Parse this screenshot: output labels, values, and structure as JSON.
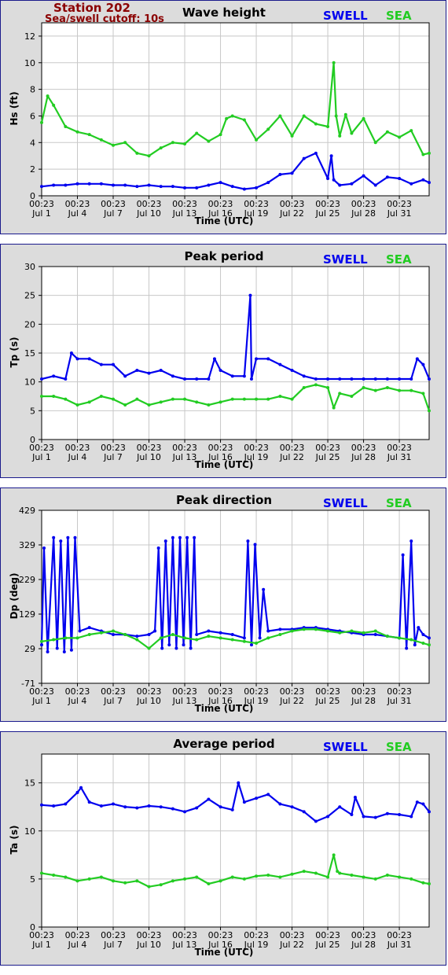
{
  "header": {
    "station": "Station 202",
    "cutoff": "Sea/swell cutoff: 10s"
  },
  "legend": {
    "swell": "SWELL",
    "sea": "SEA"
  },
  "colors": {
    "swell": "#0000ee",
    "sea": "#22cc22",
    "station": "#8b0000"
  },
  "x_ticks": [
    {
      "time": "00:23",
      "date": "Jul 1"
    },
    {
      "time": "00:23",
      "date": "Jul 4"
    },
    {
      "time": "00:23",
      "date": "Jul 7"
    },
    {
      "time": "00:23",
      "date": "Jul 10"
    },
    {
      "time": "00:23",
      "date": "Jul 13"
    },
    {
      "time": "00:23",
      "date": "Jul 16"
    },
    {
      "time": "00:23",
      "date": "Jul 19"
    },
    {
      "time": "00:23",
      "date": "Jul 22"
    },
    {
      "time": "00:23",
      "date": "Jul 25"
    },
    {
      "time": "00:23",
      "date": "Jul 28"
    },
    {
      "time": "00:23",
      "date": "Jul 31"
    }
  ],
  "chart_data": [
    {
      "type": "line",
      "title": "Wave height",
      "xlabel": "Time (UTC)",
      "ylabel": "Hs (ft)",
      "ylim": [
        0,
        13
      ],
      "yticks": [
        0,
        2,
        4,
        6,
        8,
        10,
        12
      ],
      "xlim": [
        0,
        32.5
      ],
      "grid": true,
      "series": [
        {
          "name": "SWELL",
          "x": [
            0,
            1,
            2,
            3,
            4,
            5,
            6,
            7,
            8,
            9,
            10,
            11,
            12,
            13,
            14,
            15,
            16,
            17,
            18,
            19,
            20,
            21,
            22,
            23,
            24,
            24.3,
            24.5,
            25,
            26,
            27,
            28,
            29,
            30,
            31,
            32,
            32.5
          ],
          "values": [
            0.7,
            0.8,
            0.8,
            0.9,
            0.9,
            0.9,
            0.8,
            0.8,
            0.7,
            0.8,
            0.7,
            0.7,
            0.6,
            0.6,
            0.8,
            1.0,
            0.7,
            0.5,
            0.6,
            1.0,
            1.6,
            1.7,
            2.8,
            3.2,
            1.3,
            3.0,
            1.2,
            0.8,
            0.9,
            1.5,
            0.8,
            1.4,
            1.3,
            0.9,
            1.2,
            1.0
          ]
        },
        {
          "name": "SEA",
          "x": [
            0,
            0.5,
            1,
            2,
            3,
            4,
            5,
            6,
            7,
            8,
            9,
            10,
            11,
            12,
            13,
            14,
            15,
            15.5,
            16,
            17,
            18,
            19,
            20,
            21,
            22,
            23,
            24,
            24.5,
            24.7,
            25,
            25.5,
            26,
            27,
            28,
            29,
            30,
            31,
            32,
            32.5
          ],
          "values": [
            5.5,
            7.5,
            6.8,
            5.2,
            4.8,
            4.6,
            4.2,
            3.8,
            4.0,
            3.2,
            3.0,
            3.6,
            4.0,
            3.9,
            4.7,
            4.1,
            4.6,
            5.8,
            6.0,
            5.7,
            4.2,
            5.0,
            6.0,
            4.5,
            6.0,
            5.4,
            5.2,
            10.0,
            6.0,
            4.5,
            6.1,
            4.7,
            5.8,
            4.0,
            4.8,
            4.4,
            4.9,
            3.1,
            3.2
          ]
        }
      ]
    },
    {
      "type": "line",
      "title": "Peak period",
      "xlabel": "Time (UTC)",
      "ylabel": "Tp (s)",
      "ylim": [
        0,
        30
      ],
      "yticks": [
        0,
        5,
        10,
        15,
        20,
        25,
        30
      ],
      "xlim": [
        0,
        32.5
      ],
      "grid": true,
      "series": [
        {
          "name": "SWELL",
          "x": [
            0,
            1,
            2,
            2.5,
            3,
            4,
            5,
            6,
            7,
            8,
            9,
            10,
            11,
            12,
            13,
            14,
            14.5,
            15,
            16,
            17,
            17.5,
            17.6,
            18,
            19,
            20,
            21,
            22,
            23,
            24,
            25,
            26,
            27,
            28,
            29,
            30,
            31,
            31.5,
            32,
            32.5
          ],
          "values": [
            10.5,
            11,
            10.5,
            15,
            14,
            14,
            13,
            13,
            11,
            12,
            11.5,
            12,
            11,
            10.5,
            10.5,
            10.5,
            14,
            12,
            11,
            11,
            25,
            10.5,
            14,
            14,
            13,
            12,
            11,
            10.5,
            10.5,
            10.5,
            10.5,
            10.5,
            10.5,
            10.5,
            10.5,
            10.5,
            14,
            13,
            10.5
          ]
        },
        {
          "name": "SEA",
          "x": [
            0,
            1,
            2,
            3,
            4,
            5,
            6,
            7,
            8,
            9,
            10,
            11,
            12,
            13,
            14,
            15,
            16,
            17,
            18,
            19,
            20,
            21,
            22,
            23,
            24,
            24.5,
            25,
            26,
            27,
            28,
            29,
            30,
            31,
            32,
            32.5
          ],
          "values": [
            7.5,
            7.5,
            7.0,
            6.0,
            6.5,
            7.5,
            7.0,
            6.0,
            7.0,
            6.0,
            6.5,
            7.0,
            7.0,
            6.5,
            6.0,
            6.5,
            7.0,
            7.0,
            7.0,
            7.0,
            7.5,
            7.0,
            9.0,
            9.5,
            9.0,
            5.5,
            8.0,
            7.5,
            9.0,
            8.5,
            9.0,
            8.5,
            8.5,
            8.0,
            5.0
          ]
        }
      ]
    },
    {
      "type": "line",
      "title": "Peak direction",
      "xlabel": "Time (UTC)",
      "ylabel": "Dp (deg)",
      "ylim": [
        -71,
        429
      ],
      "yticks": [
        -71,
        29,
        129,
        229,
        329,
        429
      ],
      "xlim": [
        0,
        32.5
      ],
      "grid": true,
      "series": [
        {
          "name": "SWELL",
          "x": [
            0,
            0.2,
            0.5,
            1,
            1.3,
            1.6,
            1.9,
            2.2,
            2.5,
            2.8,
            3.2,
            4,
            5,
            6,
            7,
            8,
            9,
            9.5,
            9.8,
            10.1,
            10.4,
            10.7,
            11,
            11.3,
            11.6,
            11.9,
            12.2,
            12.5,
            12.8,
            13,
            14,
            15,
            16,
            17,
            17.3,
            17.6,
            17.9,
            18.3,
            18.6,
            19,
            20,
            21,
            22,
            23,
            24,
            25,
            26,
            27,
            28,
            29,
            30,
            30.3,
            30.6,
            31,
            31.3,
            31.6,
            32,
            32.5
          ],
          "values": [
            40,
            320,
            20,
            350,
            30,
            340,
            20,
            350,
            25,
            350,
            80,
            90,
            80,
            70,
            70,
            65,
            70,
            80,
            320,
            30,
            340,
            40,
            350,
            30,
            350,
            40,
            350,
            30,
            350,
            70,
            80,
            75,
            70,
            60,
            340,
            40,
            330,
            60,
            200,
            80,
            85,
            85,
            90,
            90,
            85,
            80,
            75,
            70,
            70,
            65,
            60,
            300,
            30,
            340,
            40,
            90,
            70,
            60
          ]
        },
        {
          "name": "SEA",
          "x": [
            0,
            1,
            2,
            3,
            4,
            5,
            6,
            7,
            8,
            9,
            10,
            11,
            12,
            13,
            14,
            15,
            16,
            17,
            18,
            19,
            20,
            21,
            22,
            23,
            24,
            25,
            26,
            27,
            28,
            29,
            30,
            31,
            32,
            32.5
          ],
          "values": [
            50,
            55,
            60,
            60,
            70,
            75,
            80,
            70,
            55,
            30,
            60,
            70,
            60,
            55,
            65,
            60,
            55,
            50,
            45,
            60,
            70,
            80,
            85,
            85,
            80,
            75,
            80,
            75,
            80,
            65,
            60,
            55,
            45,
            40
          ]
        }
      ]
    },
    {
      "type": "line",
      "title": "Average period",
      "xlabel": "Time (UTC)",
      "ylabel": "Ta (s)",
      "ylim": [
        0,
        18
      ],
      "yticks": [
        0,
        5,
        10,
        15
      ],
      "xlim": [
        0,
        32.5
      ],
      "grid": true,
      "series": [
        {
          "name": "SWELL",
          "x": [
            0,
            1,
            2,
            3,
            3.3,
            4,
            5,
            6,
            7,
            8,
            9,
            10,
            11,
            12,
            13,
            14,
            15,
            16,
            16.5,
            17,
            18,
            19,
            20,
            21,
            22,
            23,
            24,
            25,
            26,
            26.3,
            27,
            28,
            29,
            30,
            31,
            31.5,
            32,
            32.5
          ],
          "values": [
            12.7,
            12.6,
            12.8,
            14,
            14.5,
            13,
            12.6,
            12.8,
            12.5,
            12.4,
            12.6,
            12.5,
            12.3,
            12.0,
            12.4,
            13.3,
            12.5,
            12.2,
            15.0,
            13.0,
            13.4,
            13.8,
            12.8,
            12.5,
            12.0,
            11.0,
            11.5,
            12.5,
            11.7,
            13.5,
            11.5,
            11.4,
            11.8,
            11.7,
            11.5,
            13.0,
            12.8,
            12.0
          ]
        },
        {
          "name": "SEA",
          "x": [
            0,
            1,
            2,
            3,
            4,
            5,
            6,
            7,
            8,
            9,
            10,
            11,
            12,
            13,
            14,
            15,
            16,
            17,
            18,
            19,
            20,
            21,
            22,
            23,
            24,
            24.5,
            24.8,
            25,
            26,
            27,
            28,
            29,
            30,
            31,
            32,
            32.5
          ],
          "values": [
            5.6,
            5.4,
            5.2,
            4.8,
            5.0,
            5.2,
            4.8,
            4.6,
            4.8,
            4.2,
            4.4,
            4.8,
            5.0,
            5.2,
            4.5,
            4.8,
            5.2,
            5.0,
            5.3,
            5.4,
            5.2,
            5.5,
            5.8,
            5.6,
            5.2,
            7.5,
            5.8,
            5.6,
            5.4,
            5.2,
            5.0,
            5.4,
            5.2,
            5.0,
            4.6,
            4.5
          ]
        }
      ]
    }
  ]
}
